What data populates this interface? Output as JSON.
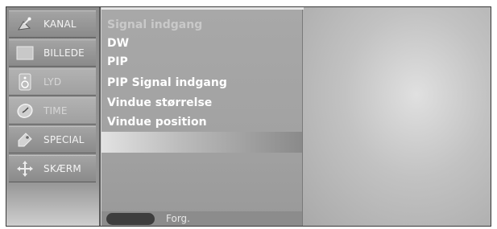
{
  "sidebar": {
    "items": [
      {
        "label": "KANAL",
        "icon": "satellite-dish-icon"
      },
      {
        "label": "BILLEDE",
        "icon": "picture-icon"
      },
      {
        "label": "LYD",
        "icon": "speaker-icon"
      },
      {
        "label": "TIME",
        "icon": "clock-icon"
      },
      {
        "label": "SPECIAL",
        "icon": "tag-icon"
      },
      {
        "label": "SKÆRM",
        "icon": "move-arrows-icon"
      }
    ]
  },
  "submenu": {
    "items": [
      {
        "label": "Signal  indgang"
      },
      {
        "label": "DW"
      },
      {
        "label": "PIP"
      },
      {
        "label": "PIP Signal  indgang"
      },
      {
        "label": "Vindue størrelse"
      },
      {
        "label": "Vindue position"
      }
    ]
  },
  "footer": {
    "label": "Forg."
  }
}
